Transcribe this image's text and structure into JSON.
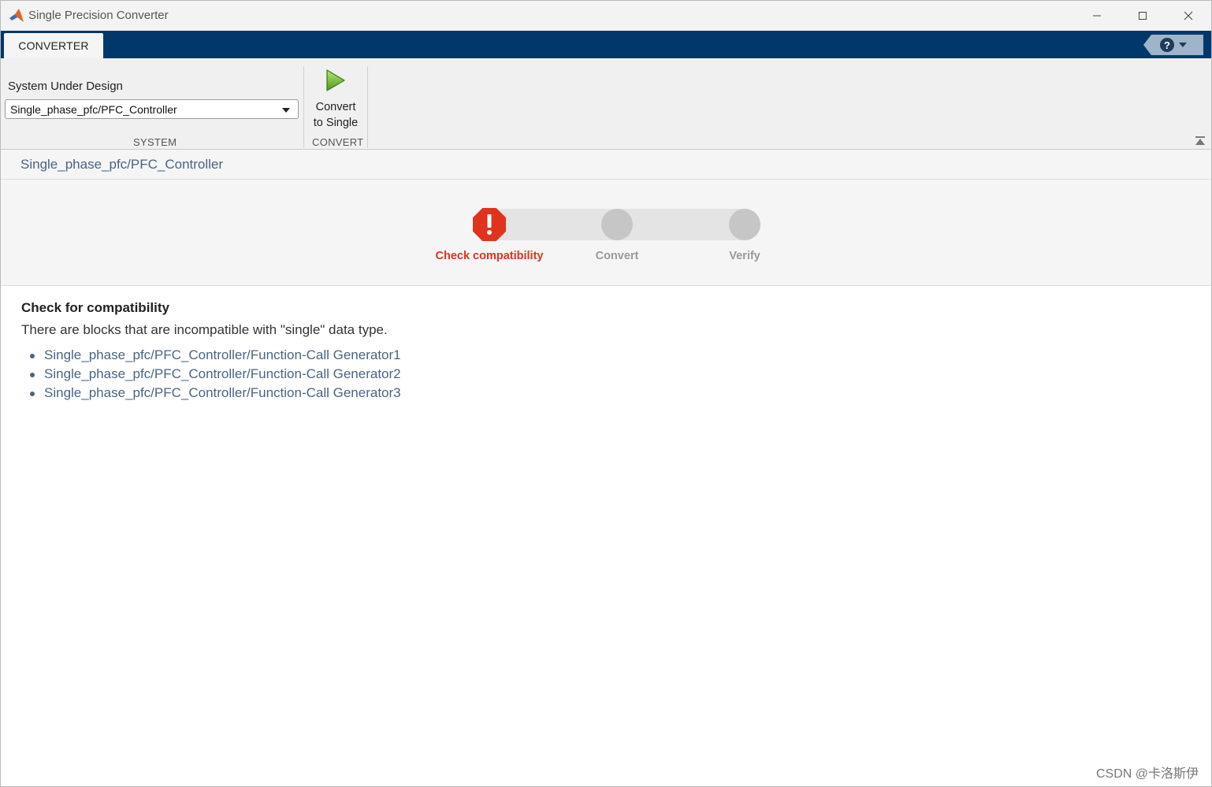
{
  "window": {
    "title": "Single Precision Converter"
  },
  "ribbon": {
    "tab_label": "CONVERTER",
    "help_icon": "help-icon",
    "system": {
      "field_label": "System Under Design",
      "selected_value": "Single_phase_pfc/PFC_Controller",
      "group_label": "SYSTEM"
    },
    "convert": {
      "button_line1": "Convert",
      "button_line2": "to Single",
      "group_label": "CONVERT"
    }
  },
  "breadcrumb": "Single_phase_pfc/PFC_Controller",
  "steps": [
    {
      "label": "Check compatibility",
      "status": "error"
    },
    {
      "label": "Convert",
      "status": "pending"
    },
    {
      "label": "Verify",
      "status": "pending"
    }
  ],
  "result": {
    "heading": "Check for compatibility",
    "message": "There are blocks that are incompatible with \"single\" data type.",
    "blocks": [
      "Single_phase_pfc/PFC_Controller/Function-Call Generator1",
      "Single_phase_pfc/PFC_Controller/Function-Call Generator2",
      "Single_phase_pfc/PFC_Controller/Function-Call Generator3"
    ]
  },
  "watermark": "CSDN @卡洛斯伊",
  "colors": {
    "ribbon_tab_bar": "#00386b",
    "error": "#e0331e",
    "link": "#4a6484",
    "pending": "#c6c6c6"
  }
}
